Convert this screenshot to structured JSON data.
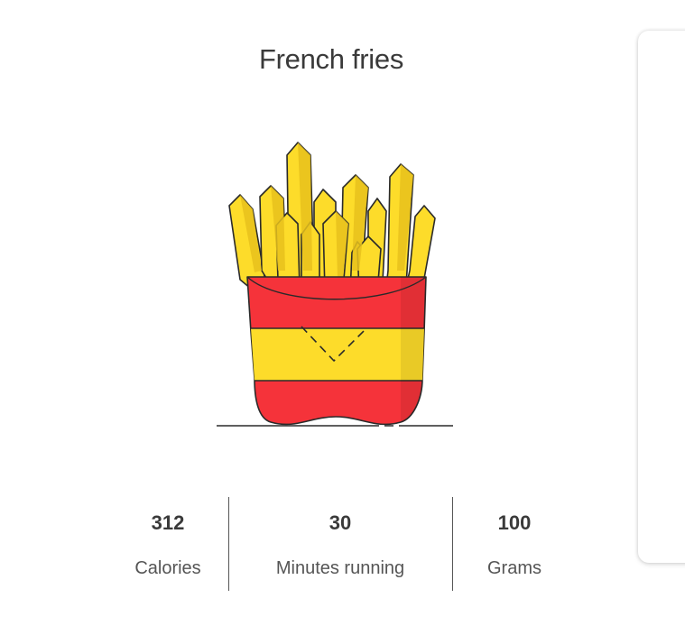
{
  "food": {
    "title": "French fries"
  },
  "illustration": {
    "icon": "french-fries-icon",
    "colors": {
      "fries": "#fddc2a",
      "fries_shadow": "#e8c21d",
      "box_red": "#f5333a",
      "box_yellow": "#fddc2a",
      "outline": "#2a2a2a"
    }
  },
  "stats": [
    {
      "value": "312",
      "label": "Calories"
    },
    {
      "value": "30",
      "label": "Minutes running"
    },
    {
      "value": "100",
      "label": "Grams"
    }
  ]
}
